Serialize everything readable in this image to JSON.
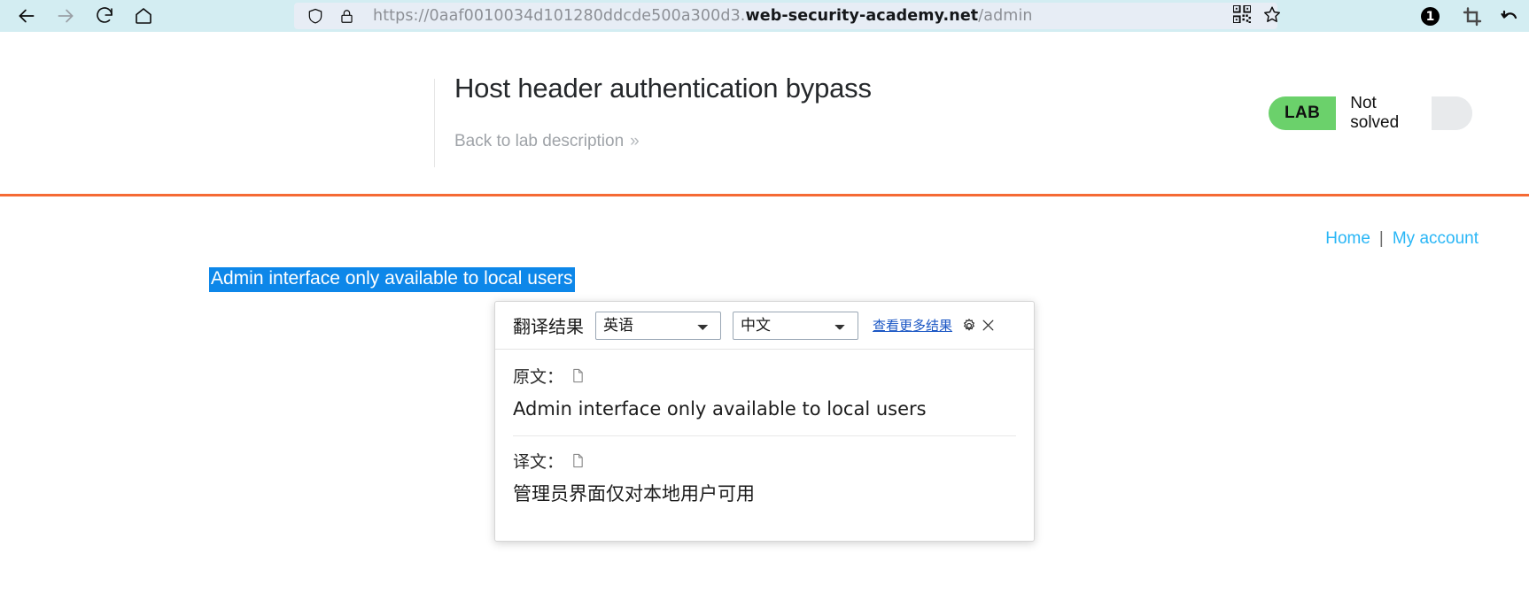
{
  "browser": {
    "back_icon": "arrow-left-icon",
    "forward_icon": "arrow-right-icon",
    "reload_icon": "reload-icon",
    "home_icon": "home-icon",
    "shield_icon": "shield-icon",
    "lock_icon": "lock-icon",
    "url": {
      "scheme": "https://",
      "subdomain": "0aaf0010034d101280ddcde500a300d3.",
      "domain": "web-security-academy.net",
      "path": "/admin",
      "full": "https://0aaf0010034d101280ddcde500a300d3.web-security-academy.net/admin"
    },
    "qr_icon": "qr-code-icon",
    "bookmark_icon": "star-icon",
    "extension_badge_count": "1",
    "crop_icon": "crop-icon",
    "undo_icon": "undo-arrow-icon",
    "toolbar_bg": "#d3edf2",
    "urlbar_bg": "#e7edf5"
  },
  "lab": {
    "title": "Host header authentication bypass",
    "back_link": "Back to lab description",
    "back_link_chevron": "»",
    "status_tag": "LAB",
    "status_text": "Not solved",
    "status_tag_color": "#6bd16b",
    "rule_color": "#f56a34"
  },
  "site": {
    "nav": {
      "home": "Home",
      "separator": "|",
      "my_account": "My account"
    },
    "admin_message": "Admin interface only available to local users",
    "selection_color": "#0d87e9"
  },
  "translate_popup": {
    "title": "翻译结果",
    "source_lang": "英语",
    "target_lang": "中文",
    "more_results_link": "查看更多结果",
    "settings_icon": "gear-icon",
    "close_icon": "close-icon",
    "source_label": "原文：",
    "source_copy_icon": "copy-icon",
    "source_text": "Admin interface only available to local users",
    "target_label": "译文：",
    "target_copy_icon": "copy-icon",
    "target_text": "管理员界面仅对本地用户可用",
    "source_lang_options": [
      "英语"
    ],
    "target_lang_options": [
      "中文"
    ]
  }
}
